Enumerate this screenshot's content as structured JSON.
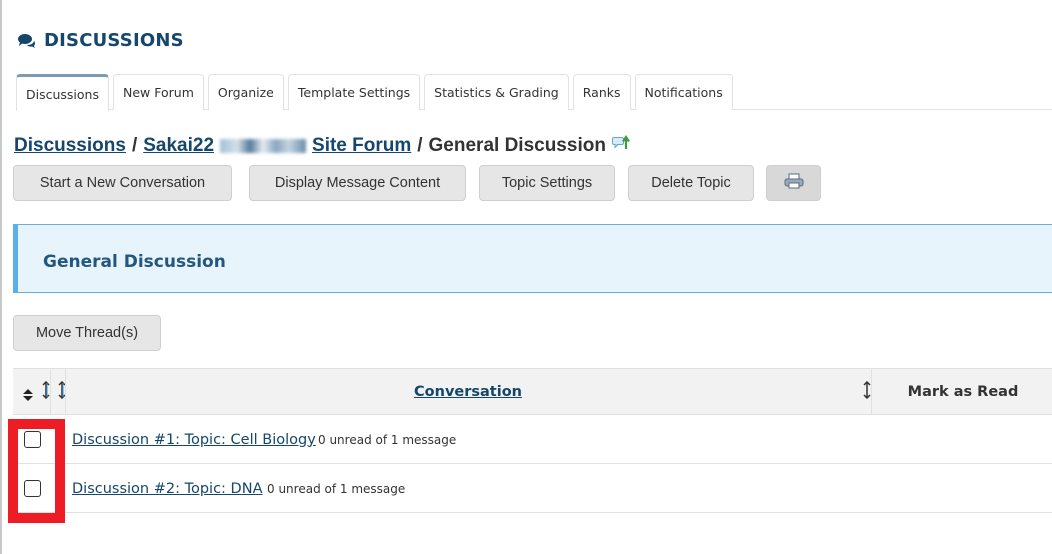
{
  "tool": {
    "title": "DISCUSSIONS",
    "icon": "comments-icon"
  },
  "tabs": [
    {
      "label": "Discussions",
      "active": true
    },
    {
      "label": "New Forum",
      "active": false
    },
    {
      "label": "Organize",
      "active": false
    },
    {
      "label": "Template Settings",
      "active": false
    },
    {
      "label": "Statistics & Grading",
      "active": false
    },
    {
      "label": "Ranks",
      "active": false
    },
    {
      "label": "Notifications",
      "active": false
    }
  ],
  "breadcrumb": {
    "root": "Discussions",
    "forum_prefix": "Sakai22",
    "forum_suffix": "Site Forum",
    "current": "General Discussion",
    "separator": "/",
    "subscribe_icon": "subscribe-icon"
  },
  "toolbar": {
    "start_conversation": "Start a New Conversation",
    "display_content": "Display Message Content",
    "topic_settings": "Topic Settings",
    "delete_topic": "Delete Topic",
    "print_icon": "print-icon"
  },
  "panel": {
    "title": "General Discussion"
  },
  "move_threads": "Move Thread(s)",
  "table": {
    "headers": {
      "conversation": "Conversation",
      "mark_as_read": "Mark as Read"
    },
    "rows": [
      {
        "title": "Discussion #1: Topic: Cell Biology ",
        "meta": "0 unread of 1 message",
        "checked": false
      },
      {
        "title": "Discussion #2: Topic: DNA",
        "meta": "0 unread of 1 message",
        "checked": false
      }
    ]
  },
  "colors": {
    "brand": "#15466b",
    "panel_bg": "#e8f4fc",
    "panel_border": "#5bb1e5",
    "highlight": "#ee1c25"
  }
}
